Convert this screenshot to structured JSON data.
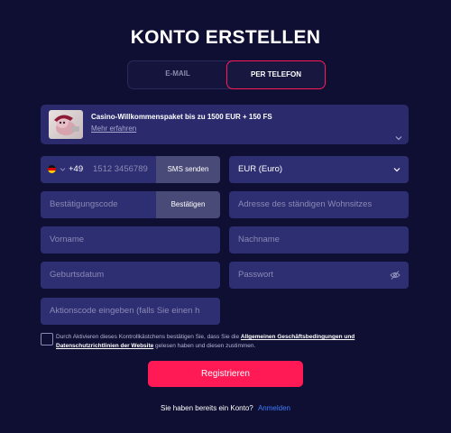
{
  "page": {
    "title": "KONTO ERSTELLEN"
  },
  "tabs": {
    "email": "E-MAIL",
    "phone": "PER TELEFON",
    "active": "phone"
  },
  "bonus": {
    "title": "Casino-Willkommenspaket bis zu 1500 EUR + 150 FS",
    "link": "Mehr erfahren"
  },
  "phone": {
    "country_code": "+49",
    "placeholder": "1512 3456789",
    "send_sms": "SMS senden"
  },
  "currency": {
    "value": "EUR (Euro)"
  },
  "verification": {
    "placeholder": "Bestätigungscode",
    "confirm": "Bestätigen"
  },
  "address": {
    "placeholder": "Adresse des ständigen Wohnsitzes"
  },
  "first_name": {
    "placeholder": "Vorname"
  },
  "last_name": {
    "placeholder": "Nachname"
  },
  "birthdate": {
    "placeholder": "Geburtsdatum"
  },
  "password": {
    "placeholder": "Passwort"
  },
  "promo": {
    "placeholder": "Aktionscode eingeben (falls Sie einen h"
  },
  "consent": {
    "text_before": "Durch Aktivieren dieses Kontrollkästchens bestätigen Sie, dass Sie die ",
    "link": "Allgemeinen Geschäftsbedingungen und Datenschutzrichtlinien der Website",
    "text_after": " gelesen haben und diesen zustimmen."
  },
  "register": {
    "label": "Registrieren"
  },
  "login": {
    "prompt": "Sie haben bereits ein Konto?",
    "link": "Anmelden"
  },
  "colors": {
    "accent": "#ff1a55",
    "background": "#0f0f33",
    "field": "#2e2e73",
    "link": "#3d7cff"
  },
  "icons": [
    "germany-flag-icon",
    "chevron-down-icon",
    "eye-off-icon",
    "promo-image"
  ]
}
